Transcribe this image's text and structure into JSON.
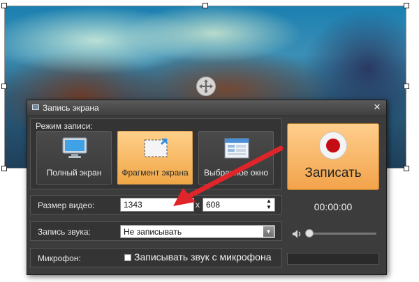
{
  "window": {
    "title": "Запись экрана",
    "close_glyph": "✕"
  },
  "mode": {
    "group_label": "Режим записи:",
    "options": [
      {
        "label": "Полный экран",
        "icon": "monitor-icon",
        "selected": false
      },
      {
        "label": "Фрагмент экрана",
        "icon": "screen-fragment-icon",
        "selected": true
      },
      {
        "label": "Выбранное окно",
        "icon": "window-icon",
        "selected": false
      }
    ]
  },
  "record": {
    "label": "Записать",
    "icon": "record-icon"
  },
  "video_size": {
    "label": "Размер видео:",
    "width": "1343",
    "separator": "x",
    "height": "608"
  },
  "audio": {
    "label": "Запись звука:",
    "selected": "Не записывать"
  },
  "microphone": {
    "label": "Микрофон:",
    "checkbox_label": "Записывать звук с микрофона",
    "checked": false
  },
  "timer": "00:00:00",
  "volume": {
    "icon": "speaker-icon",
    "level": 0.0
  },
  "colors": {
    "accent_orange": "#f2a34a",
    "record_red": "#c40d15",
    "window_bg": "#3c3c3c",
    "arrow_red": "#e0252a"
  }
}
